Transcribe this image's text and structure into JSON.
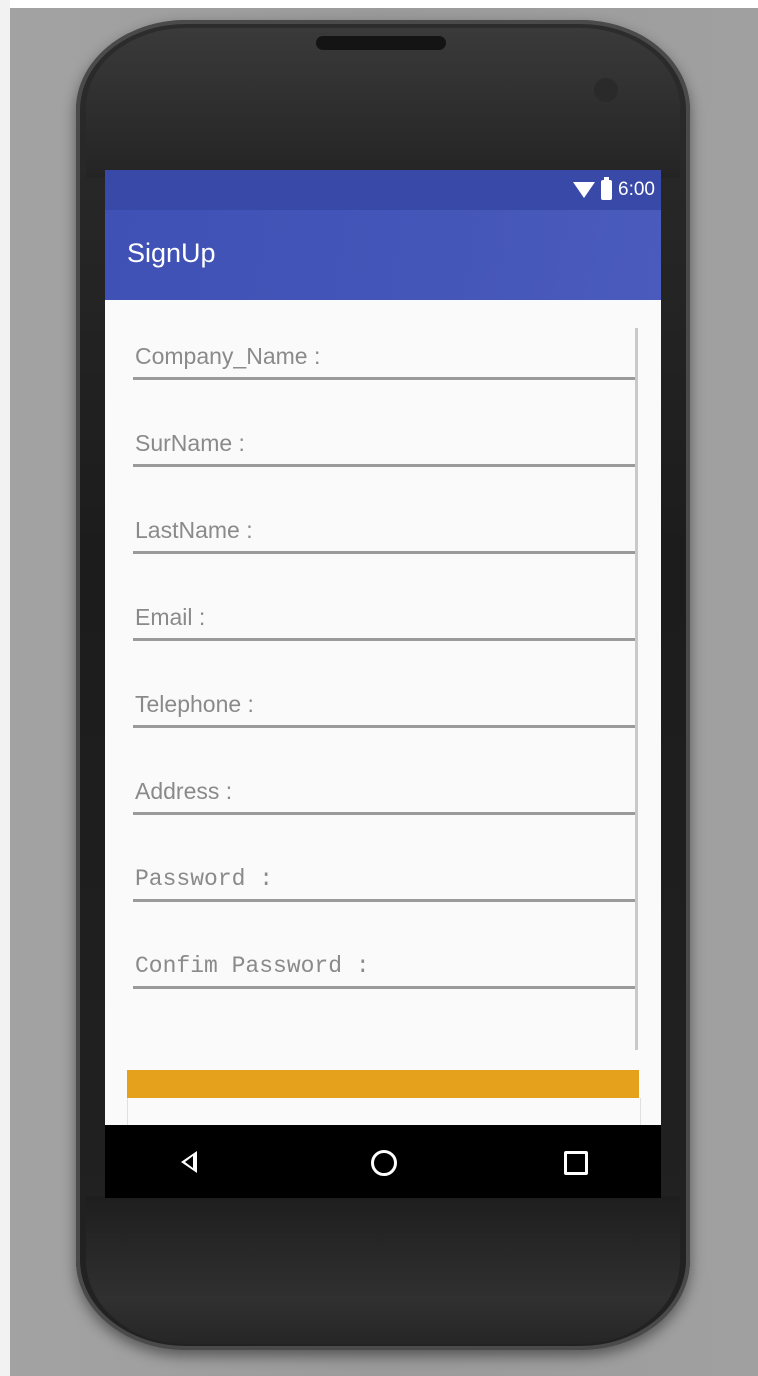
{
  "status_bar": {
    "time": "6:00",
    "wifi_icon": "wifi-icon",
    "battery_icon": "battery-icon"
  },
  "app_bar": {
    "title": "SignUp"
  },
  "form": {
    "fields": [
      {
        "label": "Company_Name :"
      },
      {
        "label": "SurName :"
      },
      {
        "label": "LastName :"
      },
      {
        "label": "Email :"
      },
      {
        "label": "Telephone :"
      },
      {
        "label": "Address :"
      },
      {
        "label": "Password :"
      },
      {
        "label": "Confim Password :"
      }
    ]
  },
  "colors": {
    "app_bar": "#3f51b5",
    "status_bar": "#3949a8",
    "button": "#e6a11c",
    "screen_bg": "#fafafa"
  },
  "nav_bar": {
    "back_icon": "back-triangle-icon",
    "home_icon": "home-circle-icon",
    "recents_icon": "recents-square-icon"
  }
}
